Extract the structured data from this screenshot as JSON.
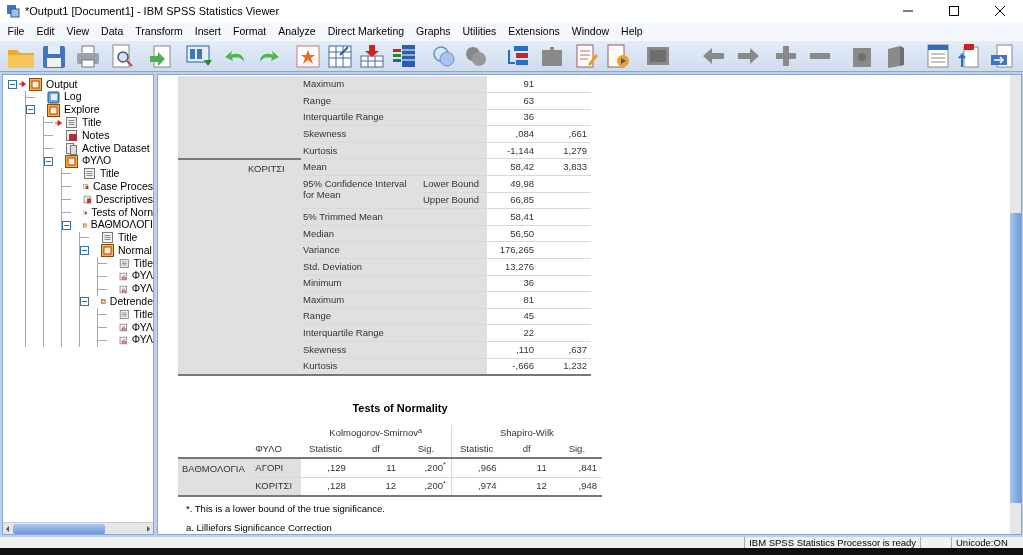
{
  "window": {
    "title": "*Output1 [Document1] - IBM SPSS Statistics Viewer"
  },
  "menu": [
    "File",
    "Edit",
    "View",
    "Data",
    "Transform",
    "Insert",
    "Format",
    "Analyze",
    "Direct Marketing",
    "Graphs",
    "Utilities",
    "Extensions",
    "Window",
    "Help"
  ],
  "tree": [
    {
      "label": "Output",
      "kind": "folder",
      "expanded": true,
      "current": true,
      "children": [
        {
          "label": "Log",
          "kind": "log",
          "current": false
        },
        {
          "label": "Explore",
          "kind": "folder",
          "expanded": true,
          "current": false,
          "children": [
            {
              "label": "Title",
              "kind": "title",
              "current": true
            },
            {
              "label": "Notes",
              "kind": "notes",
              "current": false
            },
            {
              "label": "Active Dataset",
              "kind": "dataset",
              "current": false
            },
            {
              "label": "ΦΥΛΟ",
              "kind": "folder",
              "expanded": true,
              "current": false,
              "children": [
                {
                  "label": "Title",
                  "kind": "title",
                  "current": false
                },
                {
                  "label": "Case Proces",
                  "kind": "table",
                  "current": false
                },
                {
                  "label": "Descriptives",
                  "kind": "table",
                  "current": false
                },
                {
                  "label": "Tests of Norn",
                  "kind": "table",
                  "current": false
                },
                {
                  "label": "ΒΑΘΜΟΛΟΓΙ",
                  "kind": "folder",
                  "expanded": true,
                  "current": false,
                  "children": [
                    {
                      "label": "Title",
                      "kind": "title",
                      "current": false
                    },
                    {
                      "label": "Normal",
                      "kind": "folder",
                      "expanded": true,
                      "current": false,
                      "children": [
                        {
                          "label": "Title",
                          "kind": "title",
                          "current": false
                        },
                        {
                          "label": "ΦΥΛ",
                          "kind": "chart",
                          "current": false
                        },
                        {
                          "label": "ΦΥΛ",
                          "kind": "chart",
                          "current": false
                        }
                      ]
                    },
                    {
                      "label": "Detrende",
                      "kind": "folder",
                      "expanded": true,
                      "current": false,
                      "children": [
                        {
                          "label": "Title",
                          "kind": "title",
                          "current": false
                        },
                        {
                          "label": "ΦΥΛ",
                          "kind": "chart",
                          "current": false
                        },
                        {
                          "label": "ΦΥΛ",
                          "kind": "chart",
                          "current": false
                        }
                      ]
                    }
                  ]
                }
              ]
            }
          ]
        }
      ]
    }
  ],
  "descriptives": {
    "groups": [
      {
        "rows": [
          {
            "statistic": "Maximum",
            "value": "91"
          },
          {
            "statistic": "Range",
            "value": "63"
          },
          {
            "statistic": "Interquartile Range",
            "value": "36"
          },
          {
            "statistic": "Skewness",
            "value": ",084",
            "std_error": ",661"
          },
          {
            "statistic": "Kurtosis",
            "value": "-1,144",
            "std_error": "1,279"
          }
        ]
      },
      {
        "label": "ΚΟΡΙΤΣΙ",
        "rows": [
          {
            "statistic": "Mean",
            "value": "58,42",
            "std_error": "3,833"
          },
          {
            "statistic": "95% Confidence Interval for Mean",
            "bounds": [
              {
                "label": "Lower Bound",
                "value": "49,98"
              },
              {
                "label": "Upper Bound",
                "value": "66,85"
              }
            ]
          },
          {
            "statistic": "5% Trimmed Mean",
            "value": "58,41"
          },
          {
            "statistic": "Median",
            "value": "56,50"
          },
          {
            "statistic": "Variance",
            "value": "176,265"
          },
          {
            "statistic": "Std. Deviation",
            "value": "13,276"
          },
          {
            "statistic": "Minimum",
            "value": "36"
          },
          {
            "statistic": "Maximum",
            "value": "81"
          },
          {
            "statistic": "Range",
            "value": "45"
          },
          {
            "statistic": "Interquartile Range",
            "value": "22"
          },
          {
            "statistic": "Skewness",
            "value": ",110",
            "std_error": ",637"
          },
          {
            "statistic": "Kurtosis",
            "value": "-,666",
            "std_error": "1,232"
          }
        ]
      }
    ]
  },
  "normality": {
    "title": "Tests of Normality",
    "test_headers": [
      "Kolmogorov-Smirnov$^{a}$",
      "Shapiro-Wilk"
    ],
    "group_header": "ΦΥΛΟ",
    "columns": [
      "Statistic",
      "df",
      "Sig.",
      "Statistic",
      "df",
      "Sig."
    ],
    "variable": "ΒΑΘΜΟΛΟΓΙΑ",
    "rows": [
      {
        "group": "ΑΓΟΡΙ",
        "cells": [
          ",129",
          "11",
          ",200$^{*}$",
          ",966",
          "11",
          ",841"
        ]
      },
      {
        "group": "ΚΟΡΙΤΣΙ",
        "cells": [
          ",128",
          "12",
          ",200$^{*}$",
          ",974",
          "12",
          ",948"
        ]
      }
    ],
    "footnotes": [
      "*. This is a lower bound of the true significance.",
      "a. Lilliefors Significance Correction"
    ]
  },
  "status_bar": [
    "IBM SPSS Statistics Processor is ready",
    "Unicode:ON"
  ]
}
